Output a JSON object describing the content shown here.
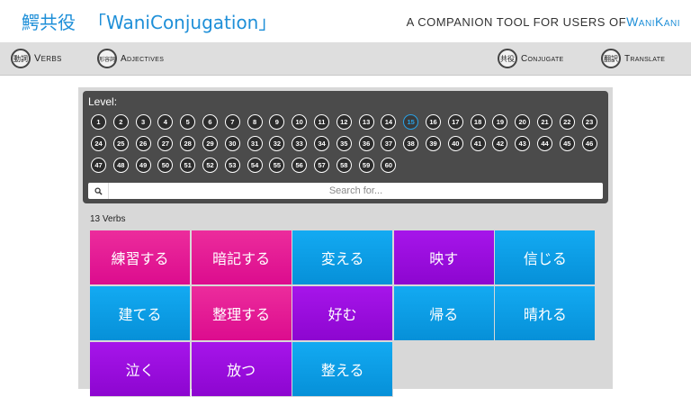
{
  "header": {
    "logo_kanji": "鰐共役",
    "logo_open": "「",
    "logo_text": "WaniConjugation",
    "logo_close": "」",
    "tagline_prefix": "A COMPANION TOOL FOR USERS OF",
    "tagline_brand": "WaniKani"
  },
  "nav": {
    "verbs": {
      "icon": "動詞",
      "label": "Verbs"
    },
    "adjectives": {
      "icon": "形容詞",
      "label": "Adjectives"
    },
    "conjugate": {
      "icon": "共役",
      "label": "Conjugate"
    },
    "translate": {
      "icon": "翻訳",
      "label": "Translate"
    }
  },
  "filter": {
    "level_label": "Level:",
    "levels": [
      "1",
      "2",
      "3",
      "4",
      "5",
      "6",
      "7",
      "8",
      "9",
      "10",
      "11",
      "12",
      "13",
      "14",
      "15",
      "16",
      "17",
      "18",
      "19",
      "20",
      "21",
      "22",
      "23",
      "24",
      "25",
      "26",
      "27",
      "28",
      "29",
      "30",
      "31",
      "32",
      "33",
      "34",
      "35",
      "36",
      "37",
      "38",
      "39",
      "40",
      "41",
      "42",
      "43",
      "44",
      "45",
      "46",
      "47",
      "48",
      "49",
      "50",
      "51",
      "52",
      "53",
      "54",
      "55",
      "56",
      "57",
      "58",
      "59",
      "60"
    ],
    "selected_level": "15",
    "search_placeholder": "Search for..."
  },
  "results": {
    "count_text": "13 Verbs",
    "verbs": [
      {
        "text": "練習する",
        "color": "pink"
      },
      {
        "text": "暗記する",
        "color": "pink"
      },
      {
        "text": "変える",
        "color": "blue"
      },
      {
        "text": "映す",
        "color": "purple"
      },
      {
        "text": "信じる",
        "color": "blue"
      },
      {
        "text": "建てる",
        "color": "blue"
      },
      {
        "text": "整理する",
        "color": "pink"
      },
      {
        "text": "好む",
        "color": "purple"
      },
      {
        "text": "帰る",
        "color": "blue"
      },
      {
        "text": "晴れる",
        "color": "blue"
      },
      {
        "text": "泣く",
        "color": "purple"
      },
      {
        "text": "放つ",
        "color": "purple"
      },
      {
        "text": "整える",
        "color": "blue"
      }
    ]
  },
  "colors": {
    "accent": "#1e8fd8",
    "pink": "#e21795",
    "blue": "#0b9de4",
    "purple": "#990cdd",
    "active_level": "#29a3e8"
  }
}
